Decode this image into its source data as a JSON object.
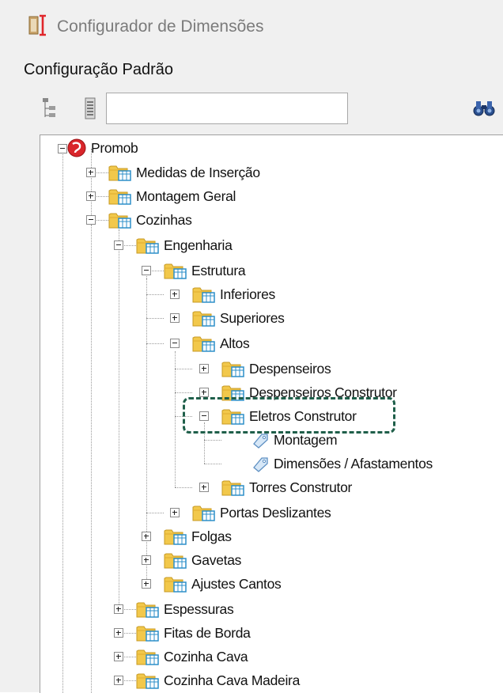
{
  "window": {
    "title": "Configurador de Dimensões",
    "icon": "ruler-icon"
  },
  "section_label": "Configuração Padrão",
  "toolbar": {
    "icons": [
      "expand-tree-icon",
      "collapse-tree-icon",
      "binoculars-find-icon"
    ],
    "search_value": ""
  },
  "tree": {
    "root": "Promob",
    "nodes": {
      "medidas": "Medidas de Inserção",
      "montagem_geral": "Montagem Geral",
      "cozinhas": "Cozinhas",
      "engenharia": "Engenharia",
      "estrutura": "Estrutura",
      "inferiores": "Inferiores",
      "superiores": "Superiores",
      "altos": "Altos",
      "despenseiros": "Despenseiros",
      "despenseiros_construtor": "Despenseiros Construtor",
      "eletros_construtor": "Eletros Construtor",
      "montagem": "Montagem",
      "dimensoes": "Dimensões / Afastamentos",
      "torres": "Torres Construtor",
      "portas": "Portas Deslizantes",
      "folgas": "Folgas",
      "gavetas": "Gavetas",
      "ajustes": "Ajustes Cantos",
      "espessuras": "Espessuras",
      "fitas": "Fitas de Borda",
      "cozinha_cava": "Cozinha Cava",
      "cozinha_cava_madeira": "Cozinha Cava Madeira"
    }
  },
  "highlight_color": "#1f5f4a"
}
